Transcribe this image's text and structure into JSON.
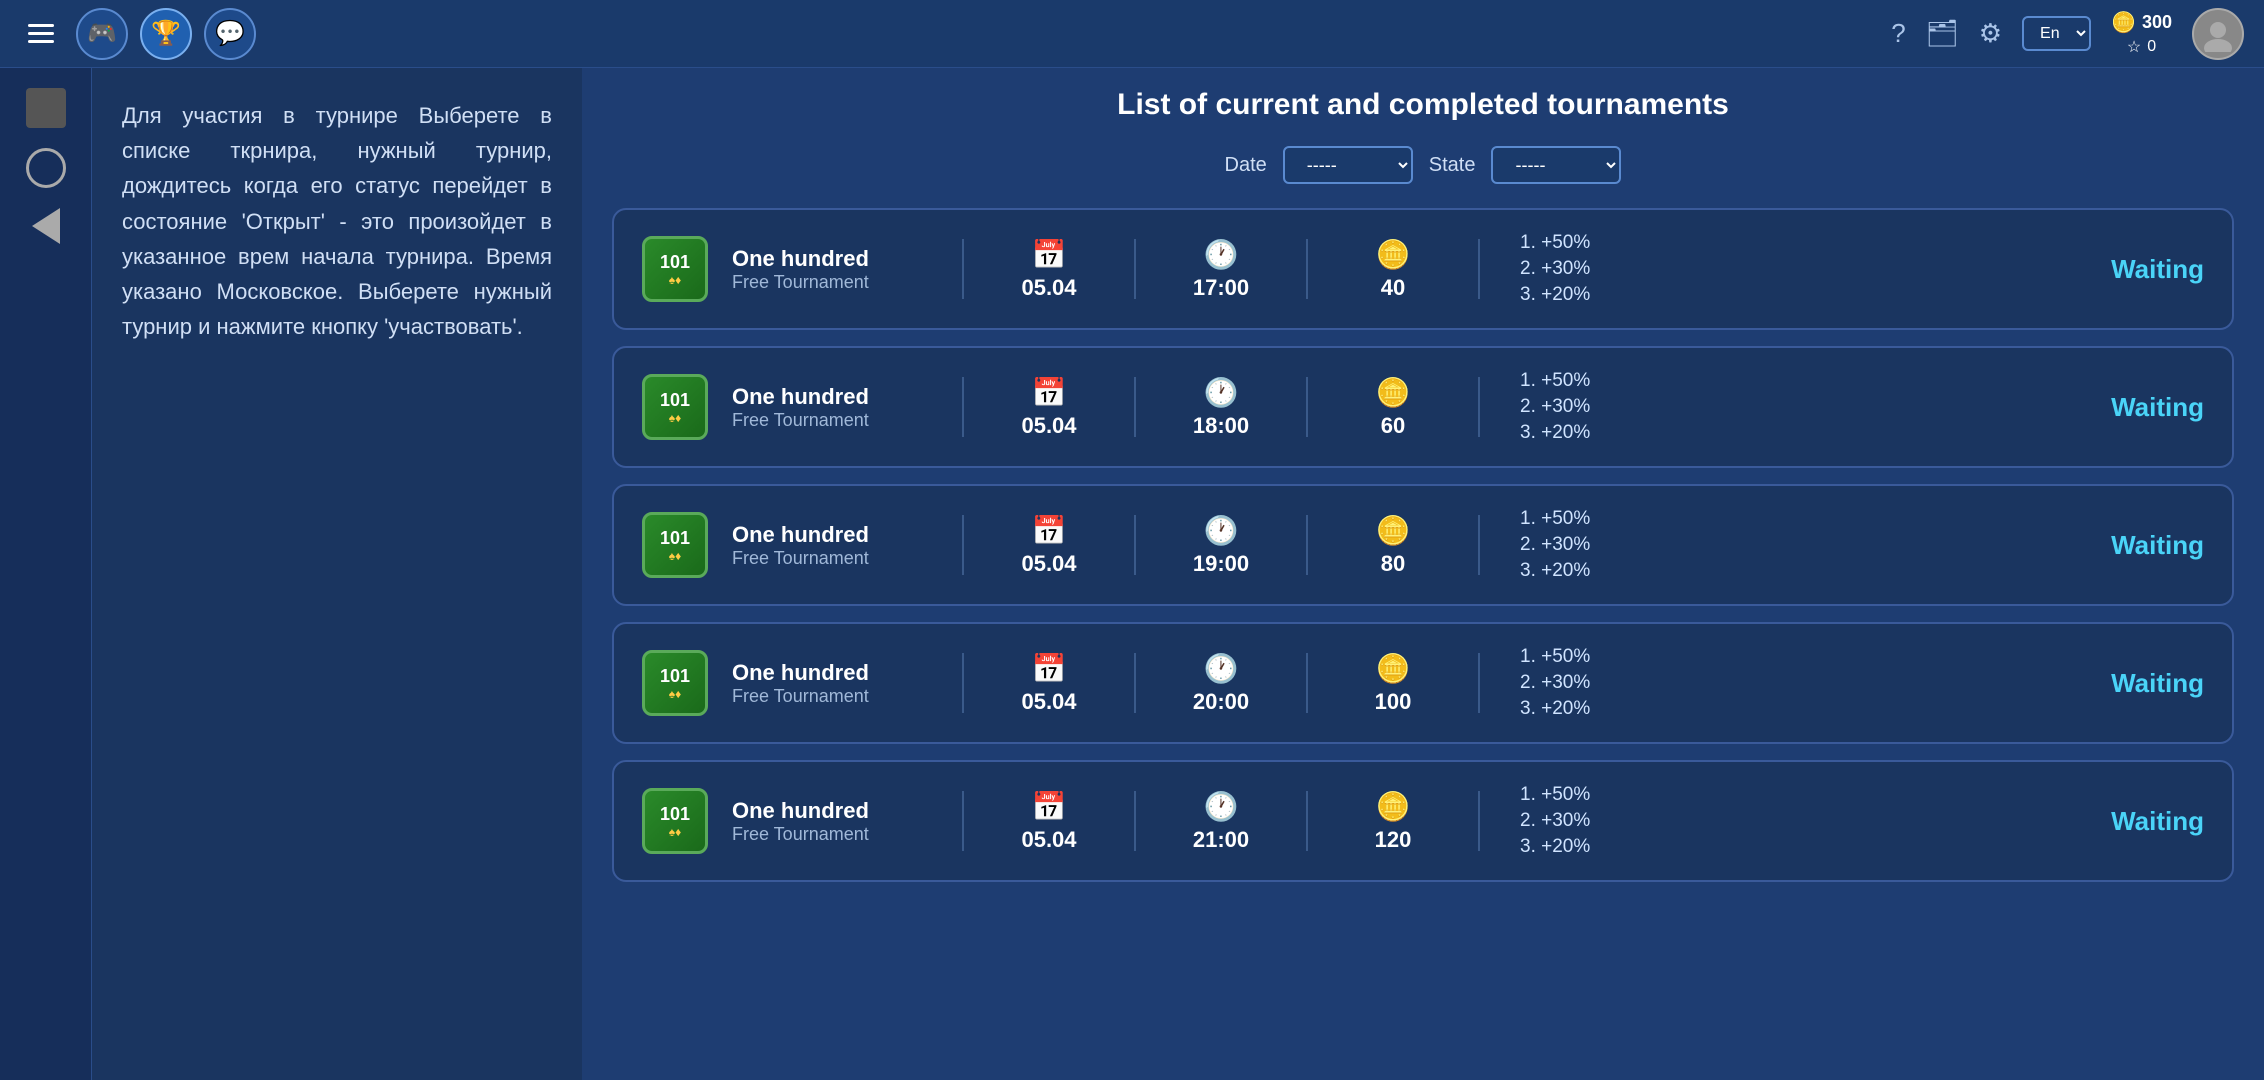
{
  "topbar": {
    "menu_icon": "☰",
    "nav_buttons": [
      {
        "icon": "🎮",
        "label": "games-icon",
        "active": false
      },
      {
        "icon": "🏆",
        "label": "trophy-icon",
        "active": true
      },
      {
        "icon": "💬",
        "label": "chat-icon",
        "active": false
      }
    ],
    "help_label": "?",
    "wallet_icon": "🗂",
    "gear_icon": "⚙",
    "lang": "En",
    "coins_amount": "300",
    "stars_amount": "0",
    "currency_icon": "🪙",
    "star_icon": "☆"
  },
  "page_title": "List of current and completed tournaments",
  "filters": {
    "date_label": "Date",
    "date_default": "-----",
    "state_label": "State",
    "state_default": "-----"
  },
  "info_text": "Для участия в турнире Выберете в списке ткрнира, нужный турнир, дождитесь когда его статус перейдет в состояние 'Открыт' - это произойдет в указанное врем начала турнира. Время указано Московское. Выберете нужный турнир и нажмите кнопку 'участвовать'.",
  "tournaments": [
    {
      "id": "t1",
      "name": "One hundred",
      "type": "Free Tournament",
      "icon_num": "101",
      "date": "05.04",
      "time": "17:00",
      "players": "40",
      "prize1": "1. +50%",
      "prize2": "2. +30%",
      "prize3": "3. +20%",
      "status": "Waiting"
    },
    {
      "id": "t2",
      "name": "One hundred",
      "type": "Free Tournament",
      "icon_num": "101",
      "date": "05.04",
      "time": "18:00",
      "players": "60",
      "prize1": "1. +50%",
      "prize2": "2. +30%",
      "prize3": "3. +20%",
      "status": "Waiting"
    },
    {
      "id": "t3",
      "name": "One hundred",
      "type": "Free Tournament",
      "icon_num": "101",
      "date": "05.04",
      "time": "19:00",
      "players": "80",
      "prize1": "1. +50%",
      "prize2": "2. +30%",
      "prize3": "3. +20%",
      "status": "Waiting"
    },
    {
      "id": "t4",
      "name": "One hundred",
      "type": "Free Tournament",
      "icon_num": "101",
      "date": "05.04",
      "time": "20:00",
      "players": "100",
      "prize1": "1. +50%",
      "prize2": "2. +30%",
      "prize3": "3. +20%",
      "status": "Waiting"
    },
    {
      "id": "t5",
      "name": "One hundred",
      "type": "Free Tournament",
      "icon_num": "101",
      "date": "05.04",
      "time": "21:00",
      "players": "120",
      "prize1": "1. +50%",
      "prize2": "2. +30%",
      "prize3": "3. +20%",
      "status": "Waiting"
    }
  ],
  "colors": {
    "accent_blue": "#4ad4f8",
    "bg_dark": "#1a3560",
    "bg_main": "#1e3d72",
    "border": "#3a5a9a"
  }
}
